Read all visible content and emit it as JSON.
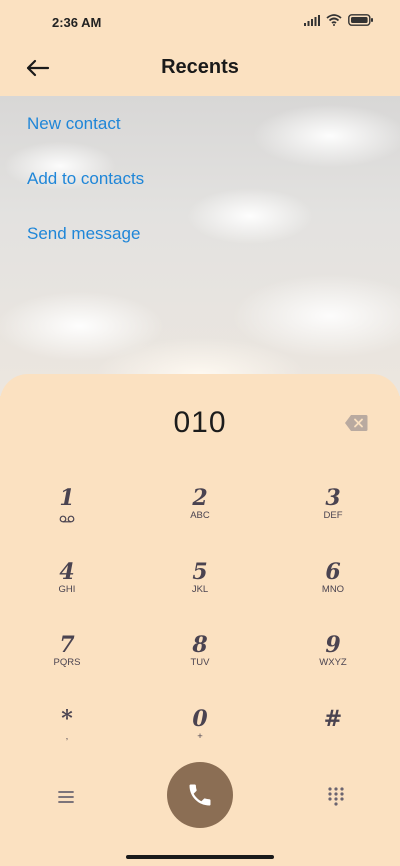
{
  "status": {
    "time": "2:36 AM"
  },
  "header": {
    "title": "Recents"
  },
  "actions": [
    {
      "label": "New contact"
    },
    {
      "label": "Add to contacts"
    },
    {
      "label": "Send message"
    }
  ],
  "dialer": {
    "number": "010",
    "keys": [
      {
        "digit": "1",
        "letters": ""
      },
      {
        "digit": "2",
        "letters": "ABC"
      },
      {
        "digit": "3",
        "letters": "DEF"
      },
      {
        "digit": "4",
        "letters": "GHI"
      },
      {
        "digit": "5",
        "letters": "JKL"
      },
      {
        "digit": "6",
        "letters": "MNO"
      },
      {
        "digit": "7",
        "letters": "PQRS"
      },
      {
        "digit": "8",
        "letters": "TUV"
      },
      {
        "digit": "9",
        "letters": "WXYZ"
      },
      {
        "digit": "*",
        "letters": ","
      },
      {
        "digit": "0",
        "letters": "+"
      },
      {
        "digit": "#",
        "letters": ""
      }
    ]
  },
  "colors": {
    "accent": "#1f86d8",
    "call": "#8b6e54",
    "panel": "#fbe1c1"
  },
  "icons": [
    "signal-icon",
    "wifi-icon",
    "battery-icon",
    "back-arrow-icon",
    "backspace-icon",
    "voicemail-icon",
    "menu-icon",
    "phone-icon",
    "dialpad-icon"
  ]
}
